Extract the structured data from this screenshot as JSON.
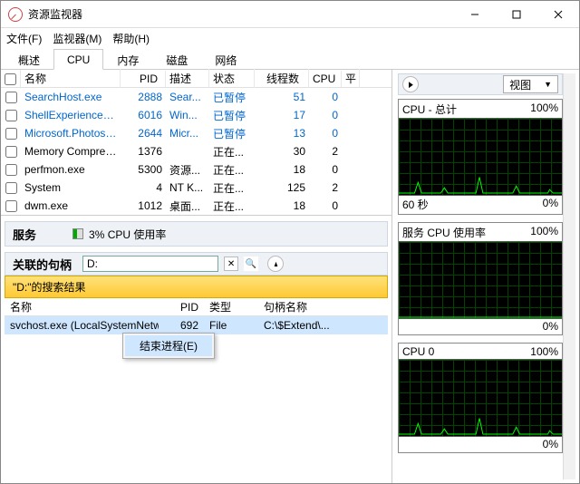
{
  "window": {
    "title": "资源监视器"
  },
  "menu": {
    "file": "文件(F)",
    "monitor": "监视器(M)",
    "help": "帮助(H)"
  },
  "tabs": {
    "overview": "概述",
    "cpu": "CPU",
    "memory": "内存",
    "disk": "磁盘",
    "network": "网络"
  },
  "proc_headers": {
    "name": "名称",
    "pid": "PID",
    "desc": "描述",
    "status": "状态",
    "threads": "线程数",
    "cpu": "CPU",
    "avg": "平"
  },
  "processes": [
    {
      "name": "SearchHost.exe",
      "pid": "2888",
      "desc": "Sear...",
      "status": "已暂停",
      "threads": "51",
      "cpu": "0",
      "link": true
    },
    {
      "name": "ShellExperienceHo...",
      "pid": "6016",
      "desc": "Win...",
      "status": "已暂停",
      "threads": "17",
      "cpu": "0",
      "link": true
    },
    {
      "name": "Microsoft.Photos.e...",
      "pid": "2644",
      "desc": "Micr...",
      "status": "已暂停",
      "threads": "13",
      "cpu": "0",
      "link": true
    },
    {
      "name": "Memory Compress...",
      "pid": "1376",
      "desc": "",
      "status": "正在...",
      "threads": "30",
      "cpu": "2",
      "link": false
    },
    {
      "name": "perfmon.exe",
      "pid": "5300",
      "desc": "资源...",
      "status": "正在...",
      "threads": "18",
      "cpu": "0",
      "link": false
    },
    {
      "name": "System",
      "pid": "4",
      "desc": "NT K...",
      "status": "正在...",
      "threads": "125",
      "cpu": "2",
      "link": false
    },
    {
      "name": "dwm.exe",
      "pid": "1012",
      "desc": "桌面...",
      "status": "正在...",
      "threads": "18",
      "cpu": "0",
      "link": false
    }
  ],
  "services": {
    "title": "服务",
    "usage_text": "3% CPU 使用率"
  },
  "handles": {
    "title": "关联的句柄",
    "search_value": "D:",
    "banner": "\"D:\"的搜索结果",
    "header": {
      "name": "名称",
      "pid": "PID",
      "type": "类型",
      "handle": "句柄名称"
    },
    "row": {
      "name": "svchost.exe (LocalSystemNetw...",
      "pid": "692",
      "type": "File",
      "handle": "C:\\$Extend\\..."
    }
  },
  "context_menu": {
    "end_process": "结束进程(E)"
  },
  "right_panel": {
    "view_label": "视图",
    "charts": [
      {
        "title": "CPU - 总计",
        "right": "100%",
        "footer_left": "60 秒",
        "footer_right": "0%",
        "spark": true
      },
      {
        "title": "服务 CPU 使用率",
        "right": "100%",
        "footer_left": "",
        "footer_right": "0%",
        "spark": false
      },
      {
        "title": "CPU 0",
        "right": "100%",
        "footer_left": "",
        "footer_right": "0%",
        "spark": true
      }
    ]
  }
}
